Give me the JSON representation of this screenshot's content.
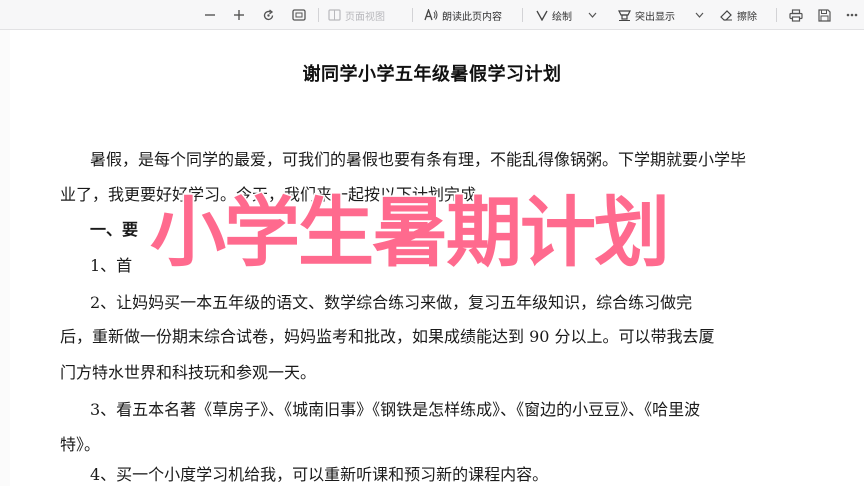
{
  "toolbar": {
    "page_view": "页面视图",
    "read_page": "朗读此页内容",
    "draw": "绘制",
    "highlight": "突出显示",
    "erase": "擦除"
  },
  "document": {
    "title": "谢同学小学五年级暑假学习计划",
    "lines": [
      "暑假，是每个同学的最爱，可我们的暑假也要有条有理，不能乱得像锅粥。下学期就要小学毕",
      "业了，我更要好好学习。今天，我们来一起按以下计划完成",
      "一、要",
      "1、首",
      "2、让妈妈买一本五年级的语文、数学综合练习来做，复习五年级知识，综合练习做完",
      "后，重新做一份期末综合试卷，妈妈监考和批改，如果成绩能达到 90 分以上。可以带我去厦",
      "门方特水世界和科技玩和参观一天。",
      "3、看五本名著《草房子》、《城南旧事》《钢铁是怎样练成》、《窗边的小豆豆》、《哈里波",
      "特》。",
      "4、买一个小度学习机给我，可以重新听课和预习新的课程内容。"
    ]
  },
  "overlay": {
    "title": "小学生暑期计划"
  }
}
